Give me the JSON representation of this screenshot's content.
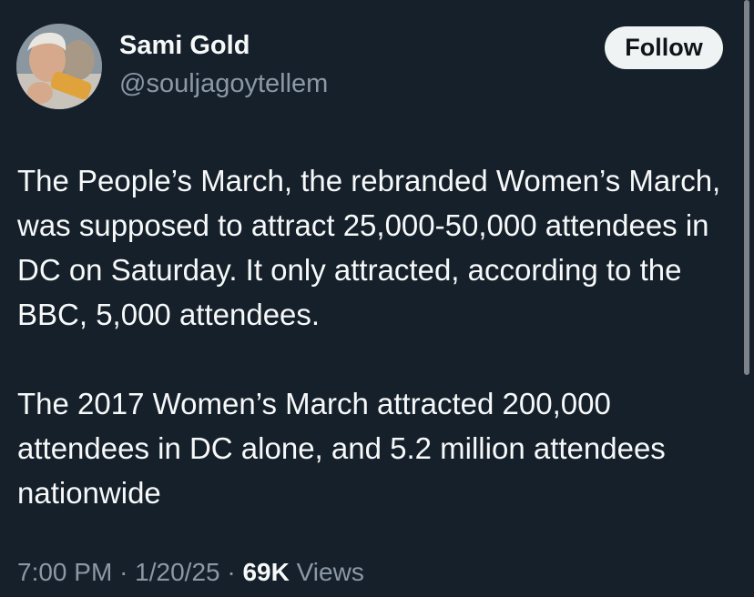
{
  "author": {
    "display_name": "Sami Gold",
    "handle": "@souljagoytellem"
  },
  "follow_button": {
    "label": "Follow"
  },
  "tweet": {
    "paragraphs": [
      "The People’s March, the rebranded Women’s March, was supposed to attract 25,000-50,000 attendees in DC on Saturday. It only attracted, according to the BBC, 5,000 attendees.",
      "The 2017 Women’s March attracted 200,000 attendees in DC alone, and 5.2 million attendees nationwide"
    ]
  },
  "meta": {
    "time": "7:00 PM",
    "separator": "·",
    "date": "1/20/25",
    "views_count": "69K",
    "views_label": "Views"
  },
  "colors": {
    "background": "#15202b",
    "primary_text": "#f7f9f9",
    "secondary_text": "#8b98a5",
    "follow_button_bg": "#eff3f4",
    "follow_button_text": "#0f1419"
  }
}
